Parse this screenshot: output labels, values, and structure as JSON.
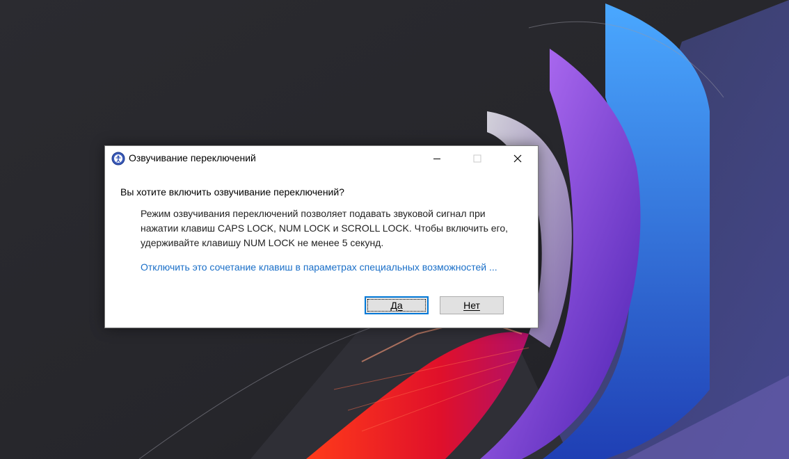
{
  "dialog": {
    "title": "Озвучивание переключений",
    "question": "Вы хотите включить озвучивание переключений?",
    "description": "Режим озвучивания переключений позволяет подавать звуковой сигнал при\nнажатии клавиш CAPS LOCK, NUM LOCK и SCROLL LOCK. Чтобы включить его,\nудерживайте клавишу NUM LOCK не менее 5 секунд.",
    "link": "Отключить это сочетание клавиш в параметрах специальных возможностей ...",
    "buttons": {
      "yes": "Да",
      "no": "Нет"
    }
  },
  "icons": {
    "app": "accessibility-icon",
    "minimize": "minimize-icon",
    "maximize": "maximize-icon",
    "close": "close-icon"
  },
  "colors": {
    "link": "#1a6fc8",
    "focus_border": "#0078d7",
    "button_bg": "#e1e1e1"
  }
}
